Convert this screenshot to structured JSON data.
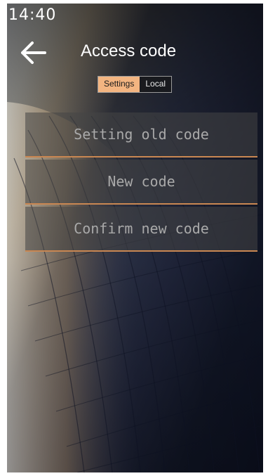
{
  "status_bar": {
    "time": "14:40"
  },
  "header": {
    "title": "Access code",
    "back_icon": "arrow-left-icon"
  },
  "tabs": [
    {
      "label": "Settings",
      "active": true
    },
    {
      "label": "Local",
      "active": false
    }
  ],
  "form": {
    "old_code_placeholder": "Setting old code",
    "new_code_placeholder": "New code",
    "confirm_code_placeholder": "Confirm new code"
  },
  "colors": {
    "accent": "#f3b581",
    "underline": "#c98752",
    "text": "#ffffff",
    "placeholder": "#a9a9a9"
  }
}
